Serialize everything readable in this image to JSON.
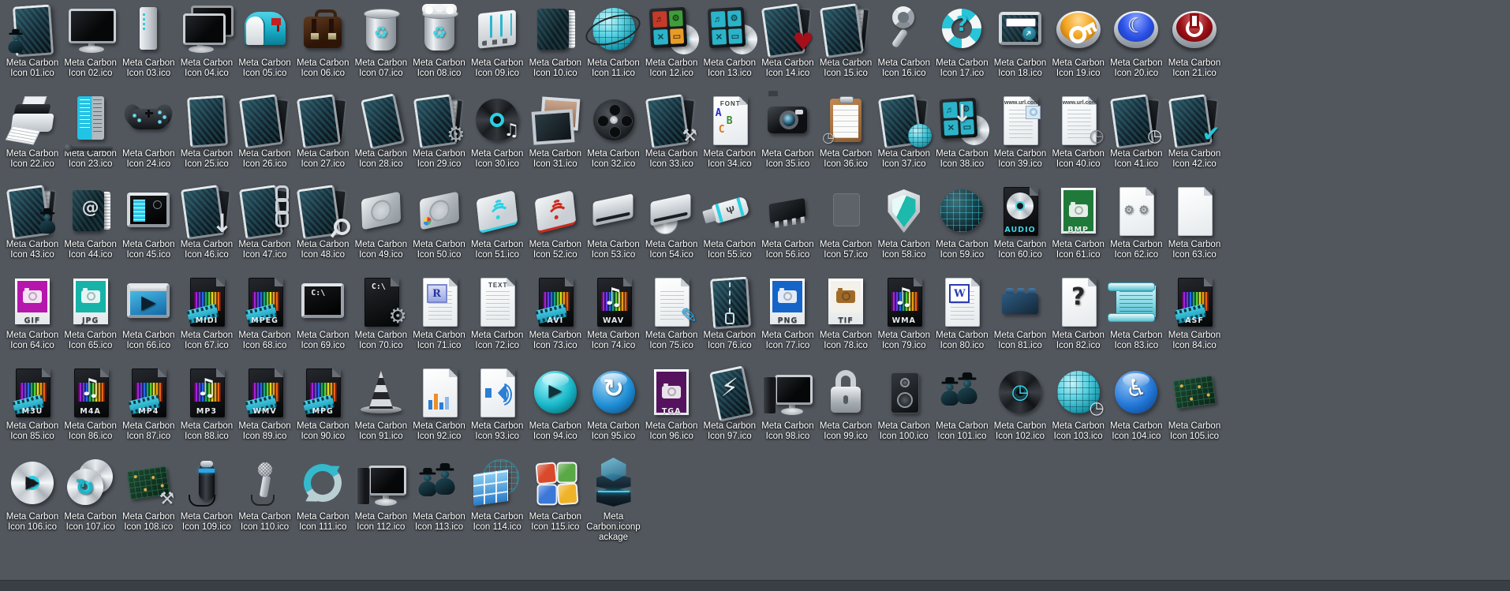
{
  "desktop": {
    "background": "#52575e",
    "bottom_bar_color": "#3a3e45",
    "label_color": "#ffffff",
    "accent_cyan": "#2bd0e4"
  },
  "items": [
    {
      "t": "Meta Carbon Icon 01.ico",
      "s": "user-panel-icon",
      "i": {
        "b": "carbon",
        "g": "user"
      }
    },
    {
      "t": "Meta Carbon Icon 02.ico",
      "s": "monitor-icon",
      "i": {
        "b": "monitor"
      }
    },
    {
      "t": "Meta Carbon Icon 03.ico",
      "s": "computer-tower-icon",
      "i": {
        "b": "tower"
      }
    },
    {
      "t": "Meta Carbon Icon 04.ico",
      "s": "dual-monitor-icon",
      "i": {
        "b": "monitor",
        "v": "dbl"
      }
    },
    {
      "t": "Meta Carbon Icon 05.ico",
      "s": "mailbox-icon",
      "i": {
        "b": "mailbox"
      }
    },
    {
      "t": "Meta Carbon Icon 06.ico",
      "s": "briefcase-icon",
      "i": {
        "b": "briefcase"
      }
    },
    {
      "t": "Meta Carbon Icon 07.ico",
      "s": "recycle-bin-empty-icon",
      "i": {
        "b": "trash",
        "g": "recycle"
      }
    },
    {
      "t": "Meta Carbon Icon 08.ico",
      "s": "recycle-bin-full-icon",
      "i": {
        "b": "trash",
        "v": "full",
        "g": "recycle"
      }
    },
    {
      "t": "Meta Carbon Icon 09.ico",
      "s": "mixer-panel-icon",
      "i": {
        "b": "mixer"
      }
    },
    {
      "t": "Meta Carbon Icon 10.ico",
      "s": "book-icon",
      "i": {
        "b": "book"
      }
    },
    {
      "t": "Meta Carbon Icon 11.ico",
      "s": "network-globe-icon",
      "i": {
        "b": "globe",
        "v": "orbit"
      }
    },
    {
      "t": "Meta Carbon Icon 12.ico",
      "s": "software-disc-icon",
      "i": {
        "b": "tiles",
        "v": "multi"
      }
    },
    {
      "t": "Meta Carbon Icon 13.ico",
      "s": "software-disc-cyan-icon",
      "i": {
        "b": "tiles"
      }
    },
    {
      "t": "Meta Carbon Icon 14.ico",
      "s": "favorites-folder-icon",
      "i": {
        "b": "carbon",
        "o": 1,
        "g": "heart"
      }
    },
    {
      "t": "Meta Carbon Icon 15.ico",
      "s": "documents-folder-icon",
      "i": {
        "b": "carbon",
        "o": 1,
        "p": 1
      }
    },
    {
      "t": "Meta Carbon Icon 16.ico",
      "s": "magnifier-icon",
      "i": {
        "b": "lens"
      }
    },
    {
      "t": "Meta Carbon Icon 17.ico",
      "s": "help-lifebuoy-icon",
      "i": {
        "b": "buoy",
        "g": "q"
      }
    },
    {
      "t": "Meta Carbon Icon 18.ico",
      "s": "run-dialog-icon",
      "i": {
        "b": "runbox"
      }
    },
    {
      "t": "Meta Carbon Icon 19.ico",
      "s": "key-button-icon",
      "i": {
        "b": "button",
        "c": "orange",
        "g": "key"
      }
    },
    {
      "t": "Meta Carbon Icon 20.ico",
      "s": "sleep-button-icon",
      "i": {
        "b": "button",
        "c": "blue",
        "g": "moon"
      }
    },
    {
      "t": "Meta Carbon Icon 21.ico",
      "s": "power-button-icon",
      "i": {
        "b": "button",
        "c": "red",
        "g": "power"
      }
    },
    {
      "t": "Meta Carbon Icon 22.ico",
      "s": "printer-icon",
      "i": {
        "b": "printer"
      }
    },
    {
      "t": "Meta Carbon Icon 23.ico",
      "s": "start-menu-icon",
      "i": {
        "b": "startmenu"
      }
    },
    {
      "t": "Meta Carbon Icon 24.ico",
      "s": "gamepad-icon",
      "i": {
        "b": "gamepad"
      }
    },
    {
      "t": "Meta Carbon Icon 25.ico",
      "s": "carbon-panel-icon",
      "i": {
        "b": "carbon"
      }
    },
    {
      "t": "Meta Carbon Icon 26.ico",
      "s": "open-folder-icon",
      "i": {
        "b": "carbon",
        "o": 1
      }
    },
    {
      "t": "Meta Carbon Icon 27.ico",
      "s": "open-folder-icon",
      "i": {
        "b": "carbon",
        "o": 1
      }
    },
    {
      "t": "Meta Carbon Icon 28.ico",
      "s": "carbon-flat-panel-icon",
      "i": {
        "b": "carbon",
        "v": "flat"
      }
    },
    {
      "t": "Meta Carbon Icon 29.ico",
      "s": "system-folder-icon",
      "i": {
        "b": "carbon",
        "o": 1,
        "p": 1,
        "g": "gear"
      }
    },
    {
      "t": "Meta Carbon Icon 30.ico",
      "s": "vinyl-record-icon",
      "i": {
        "b": "cd",
        "v": "dark",
        "g": "noteS",
        "rc": "#2bd0e4"
      }
    },
    {
      "t": "Meta Carbon Icon 31.ico",
      "s": "picture-frames-icon",
      "i": {
        "b": "frames"
      }
    },
    {
      "t": "Meta Carbon Icon 32.ico",
      "s": "film-reel-icon",
      "i": {
        "b": "reel"
      }
    },
    {
      "t": "Meta Carbon Icon 33.ico",
      "s": "tools-folder-icon",
      "i": {
        "b": "carbon",
        "o": 1,
        "g": "tools"
      }
    },
    {
      "t": "Meta Carbon Icon 34.ico",
      "s": "font-file-icon",
      "i": {
        "b": "page",
        "h": "FONT",
        "g": "abc"
      }
    },
    {
      "t": "Meta Carbon Icon 35.ico",
      "s": "camera-icon",
      "i": {
        "b": "camera"
      }
    },
    {
      "t": "Meta Carbon Icon 36.ico",
      "s": "task-clipboard-icon",
      "i": {
        "b": "clipboard",
        "g": "watchS"
      }
    },
    {
      "t": "Meta Carbon Icon 37.ico",
      "s": "network-folder-icon",
      "i": {
        "b": "carbon",
        "o": 1,
        "g": "globe-sm"
      }
    },
    {
      "t": "Meta Carbon Icon 38.ico",
      "s": "download-software-icon",
      "i": {
        "b": "tiles",
        "g": "downC"
      }
    },
    {
      "t": "Meta Carbon Icon 39.ico",
      "s": "url-document-icon",
      "i": {
        "b": "page",
        "h": "www.url.com",
        "l": 1,
        "g": "webpic"
      }
    },
    {
      "t": "Meta Carbon Icon 40.ico",
      "s": "url-history-icon",
      "i": {
        "b": "page",
        "h": "www.url.com",
        "l": 1,
        "g": "watch",
        "gc": "#8f969c"
      }
    },
    {
      "t": "Meta Carbon Icon 41.ico",
      "s": "recent-folder-icon",
      "i": {
        "b": "carbon",
        "o": 1,
        "g": "watch"
      }
    },
    {
      "t": "Meta Carbon Icon 42.ico",
      "s": "approved-folder-icon",
      "i": {
        "b": "carbon",
        "o": 1,
        "g": "check"
      }
    },
    {
      "t": "Meta Carbon Icon 43.ico",
      "s": "user-folder-icon",
      "i": {
        "b": "carbon",
        "o": 1,
        "p": 1,
        "g": "spy"
      }
    },
    {
      "t": "Meta Carbon Icon 44.ico",
      "s": "address-book-icon",
      "i": {
        "b": "book",
        "g": "at"
      }
    },
    {
      "t": "Meta Carbon Icon 45.ico",
      "s": "media-screen-icon",
      "i": {
        "b": "screenmenu"
      }
    },
    {
      "t": "Meta Carbon Icon 46.ico",
      "s": "downloads-folder-icon",
      "i": {
        "b": "carbon",
        "o": 1,
        "g": "down"
      }
    },
    {
      "t": "Meta Carbon Icon 47.ico",
      "s": "linked-folder-icon",
      "i": {
        "b": "carbon",
        "o": 1,
        "g": "chain"
      }
    },
    {
      "t": "Meta Carbon Icon 48.ico",
      "s": "search-folder-icon",
      "i": {
        "b": "carbon",
        "o": 1,
        "g": "lens-sm"
      }
    },
    {
      "t": "Meta Carbon Icon 49.ico",
      "s": "hard-drive-icon",
      "i": {
        "b": "hdd"
      }
    },
    {
      "t": "Meta Carbon Icon 50.ico",
      "s": "hard-drive-brand-icon",
      "i": {
        "b": "hdd",
        "v": "logo"
      }
    },
    {
      "t": "Meta Carbon Icon 51.ico",
      "s": "wireless-drive-cyan-icon",
      "i": {
        "b": "wifidrive",
        "c": "#2bd0e4"
      }
    },
    {
      "t": "Meta Carbon Icon 52.ico",
      "s": "wireless-drive-red-icon",
      "i": {
        "b": "wifidrive",
        "c": "#cf2a1c"
      }
    },
    {
      "t": "Meta Carbon Icon 53.ico",
      "s": "optical-drive-icon",
      "i": {
        "b": "optical"
      }
    },
    {
      "t": "Meta Carbon Icon 54.ico",
      "s": "optical-drive-disc-icon",
      "i": {
        "b": "optical",
        "v": "disc"
      }
    },
    {
      "t": "Meta Carbon Icon 55.ico",
      "s": "usb-stick-icon",
      "i": {
        "b": "usb"
      }
    },
    {
      "t": "Meta Carbon Icon 56.ico",
      "s": "memory-chip-icon",
      "i": {
        "b": "chip"
      }
    },
    {
      "t": "Meta Carbon Icon 57.ico",
      "s": "hidden-item-icon",
      "i": {
        "b": "ghost"
      }
    },
    {
      "t": "Meta Carbon Icon 58.ico",
      "s": "security-shield-icon",
      "i": {
        "b": "shield"
      }
    },
    {
      "t": "Meta Carbon Icon 59.ico",
      "s": "dark-globe-icon",
      "i": {
        "b": "globe",
        "v": "dark"
      }
    },
    {
      "t": "Meta Carbon Icon 60.ico",
      "s": "audio-cd-file-icon",
      "i": {
        "b": "darkpage",
        "g": "cd-sm",
        "bd": "AUDIO",
        "bc": "#3fd4e6"
      }
    },
    {
      "t": "Meta Carbon Icon 61.ico",
      "s": "bmp-file-icon",
      "i": {
        "b": "photocard",
        "c": "#1f7a3a",
        "v": "full",
        "bd": "BMP",
        "bc": "#eef2f4"
      }
    },
    {
      "t": "Meta Carbon Icon 62.ico",
      "s": "settings-document-icon",
      "i": {
        "b": "page",
        "g": "gears"
      }
    },
    {
      "t": "Meta Carbon Icon 63.ico",
      "s": "blank-document-icon",
      "i": {
        "b": "page"
      }
    },
    {
      "t": "Meta Carbon Icon 64.ico",
      "s": "gif-file-icon",
      "i": {
        "b": "photocard",
        "c": "#b517ad",
        "bd": "GIF",
        "bc": "#3a3f45"
      }
    },
    {
      "t": "Meta Carbon Icon 65.ico",
      "s": "jpg-file-icon",
      "i": {
        "b": "photocard",
        "c": "#17b3a8",
        "bd": "JPG",
        "bc": "#3a3f45"
      }
    },
    {
      "t": "Meta Carbon Icon 66.ico",
      "s": "video-player-icon",
      "i": {
        "b": "playscreen"
      }
    },
    {
      "t": "Meta Carbon Icon 67.ico",
      "s": "midi-file-icon",
      "i": {
        "b": "darkpage",
        "r": 1,
        "g": "film",
        "bd": "MIDI"
      }
    },
    {
      "t": "Meta Carbon Icon 68.ico",
      "s": "mpeg-file-icon",
      "i": {
        "b": "darkpage",
        "r": 1,
        "g": "film",
        "bd": "MPEG"
      }
    },
    {
      "t": "Meta Carbon Icon 69.ico",
      "s": "command-prompt-icon",
      "i": {
        "b": "terminal",
        "h": "C:\\"
      }
    },
    {
      "t": "Meta Carbon Icon 70.ico",
      "s": "command-file-icon",
      "i": {
        "b": "darkpage",
        "h": "C:\\",
        "g": "gear"
      }
    },
    {
      "t": "Meta Carbon Icon 71.ico",
      "s": "rtf-document-icon",
      "i": {
        "b": "page",
        "l": 1,
        "g": "rlogo"
      }
    },
    {
      "t": "Meta Carbon Icon 72.ico",
      "s": "text-document-icon",
      "i": {
        "b": "page",
        "h": "TEXT",
        "l": 1
      }
    },
    {
      "t": "Meta Carbon Icon 73.ico",
      "s": "avi-file-icon",
      "i": {
        "b": "darkpage",
        "r": 1,
        "g": "film",
        "bd": "AVI"
      }
    },
    {
      "t": "Meta Carbon Icon 74.ico",
      "s": "wav-file-icon",
      "i": {
        "b": "darkpage",
        "r": 1,
        "g": "note",
        "bd": "WAV"
      }
    },
    {
      "t": "Meta Carbon Icon 75.ico",
      "s": "notes-document-icon",
      "i": {
        "b": "page",
        "l": 1,
        "g": "pencil"
      }
    },
    {
      "t": "Meta Carbon Icon 76.ico",
      "s": "zip-folder-icon",
      "i": {
        "b": "carbon",
        "g": "zip"
      }
    },
    {
      "t": "Meta Carbon Icon 77.ico",
      "s": "png-file-icon",
      "i": {
        "b": "photocard",
        "c": "#1565c8",
        "bd": "PNG",
        "bc": "#3a3f45"
      }
    },
    {
      "t": "Meta Carbon Icon 78.ico",
      "s": "tif-file-icon",
      "i": {
        "b": "photocard",
        "c": "#f4f0ea",
        "cc": "#a06a28",
        "bd": "TIF",
        "bc": "#3a3f45"
      }
    },
    {
      "t": "Meta Carbon Icon 79.ico",
      "s": "wma-file-icon",
      "i": {
        "b": "darkpage",
        "r": 1,
        "g": "note",
        "bd": "WMA"
      }
    },
    {
      "t": "Meta Carbon Icon 80.ico",
      "s": "word-document-icon",
      "i": {
        "b": "page",
        "l": 1,
        "g": "wlogo"
      }
    },
    {
      "t": "Meta Carbon Icon 81.ico",
      "s": "building-block-icon",
      "i": {
        "b": "brick"
      }
    },
    {
      "t": "Meta Carbon Icon 82.ico",
      "s": "unknown-file-icon",
      "i": {
        "b": "page",
        "g": "qd"
      }
    },
    {
      "t": "Meta Carbon Icon 83.ico",
      "s": "scroll-document-icon",
      "i": {
        "b": "scroll"
      }
    },
    {
      "t": "Meta Carbon Icon 84.ico",
      "s": "asf-file-icon",
      "i": {
        "b": "darkpage",
        "r": 1,
        "g": "film",
        "bd": "ASF"
      }
    },
    {
      "t": "Meta Carbon Icon 85.ico",
      "s": "m3u-file-icon",
      "i": {
        "b": "darkpage",
        "r": 1,
        "g": "film",
        "bd": "M3U"
      }
    },
    {
      "t": "Meta Carbon Icon 86.ico",
      "s": "m4a-file-icon",
      "i": {
        "b": "darkpage",
        "r": 1,
        "g": "note",
        "bd": "M4A"
      }
    },
    {
      "t": "Meta Carbon Icon 87.ico",
      "s": "mp4-file-icon",
      "i": {
        "b": "darkpage",
        "r": 1,
        "g": "film",
        "bd": "MP4"
      }
    },
    {
      "t": "Meta Carbon Icon 88.ico",
      "s": "mp3-file-icon",
      "i": {
        "b": "darkpage",
        "r": 1,
        "g": "note",
        "bd": "MP3"
      }
    },
    {
      "t": "Meta Carbon Icon 89.ico",
      "s": "wmv-file-icon",
      "i": {
        "b": "darkpage",
        "r": 1,
        "g": "film",
        "bd": "WMV"
      }
    },
    {
      "t": "Meta Carbon Icon 90.ico",
      "s": "mpg-file-icon",
      "i": {
        "b": "darkpage",
        "r": 1,
        "g": "film",
        "bd": "MPG"
      }
    },
    {
      "t": "Meta Carbon Icon 91.ico",
      "s": "traffic-cone-icon",
      "i": {
        "b": "cone"
      }
    },
    {
      "t": "Meta Carbon Icon 92.ico",
      "s": "chart-document-icon",
      "i": {
        "b": "page",
        "g": "chart"
      }
    },
    {
      "t": "Meta Carbon Icon 93.ico",
      "s": "sound-document-icon",
      "i": {
        "b": "page",
        "g": "speaker"
      }
    },
    {
      "t": "Meta Carbon Icon 94.ico",
      "s": "play-orb-icon",
      "i": {
        "b": "orb",
        "c": "teal",
        "g": "play"
      }
    },
    {
      "t": "Meta Carbon Icon 95.ico",
      "s": "torrent-orb-icon",
      "i": {
        "b": "orb",
        "c": "blue",
        "g": "swirl"
      }
    },
    {
      "t": "Meta Carbon Icon 96.ico",
      "s": "tga-file-icon",
      "i": {
        "b": "photocard",
        "c": "#55135e",
        "v": "full",
        "bd": "TGA",
        "bc": "#eef2f4"
      }
    },
    {
      "t": "Meta Carbon Icon 97.ico",
      "s": "lightning-icon",
      "i": {
        "b": "carbon",
        "v": "flat",
        "g": "bolt"
      }
    },
    {
      "t": "Meta Carbon Icon 98.ico",
      "s": "media-workstation-icon",
      "i": {
        "b": "monitor",
        "v": "tower"
      }
    },
    {
      "t": "Meta Carbon Icon 99.ico",
      "s": "padlock-icon",
      "i": {
        "b": "lock"
      }
    },
    {
      "t": "Meta Carbon Icon 100.ico",
      "s": "loudspeaker-icon",
      "i": {
        "b": "speakerbox"
      }
    },
    {
      "t": "Meta Carbon Icon 101.ico",
      "s": "spy-users-icon",
      "i": {
        "b": "spies"
      }
    },
    {
      "t": "Meta Carbon Icon 102.ico",
      "s": "disc-time-icon",
      "i": {
        "b": "cd",
        "v": "dark",
        "g": "clock",
        "rc": "#17404a"
      }
    },
    {
      "t": "Meta Carbon Icon 103.ico",
      "s": "globe-time-icon",
      "i": {
        "b": "globe",
        "g": "watch"
      }
    },
    {
      "t": "Meta Carbon Icon 104.ico",
      "s": "accessibility-orb-icon",
      "i": {
        "b": "orb",
        "c": "mblue",
        "g": "wheel"
      }
    },
    {
      "t": "Meta Carbon Icon 105.ico",
      "s": "circuit-board-icon",
      "i": {
        "b": "pcb"
      }
    },
    {
      "t": "Meta Carbon Icon 106.ico",
      "s": "disc-play-icon",
      "i": {
        "b": "cd",
        "g": "playD",
        "rc": "#2bd0e4"
      }
    },
    {
      "t": "Meta Carbon Icon 107.ico",
      "s": "disc-sync-icon",
      "i": {
        "b": "cd",
        "v": "dbl",
        "g": "swirlT",
        "rc": "#2bd0e4"
      }
    },
    {
      "t": "Meta Carbon Icon 108.ico",
      "s": "circuit-tools-icon",
      "i": {
        "b": "pcb",
        "g": "tools"
      }
    },
    {
      "t": "Meta Carbon Icon 109.ico",
      "s": "battery-icon",
      "i": {
        "b": "battery"
      }
    },
    {
      "t": "Meta Carbon Icon 110.ico",
      "s": "microphone-icon",
      "i": {
        "b": "mic"
      }
    },
    {
      "t": "Meta Carbon Icon 111.ico",
      "s": "refresh-arrows-icon",
      "i": {
        "b": "refresh"
      }
    },
    {
      "t": "Meta Carbon Icon 112.ico",
      "s": "computer-setup-icon",
      "i": {
        "b": "monitor",
        "v": "tower"
      }
    },
    {
      "t": "Meta Carbon Icon 113.ico",
      "s": "spy-users-icon",
      "i": {
        "b": "spies"
      }
    },
    {
      "t": "Meta Carbon Icon 114.ico",
      "s": "firewall-icon",
      "i": {
        "b": "wall"
      }
    },
    {
      "t": "Meta Carbon Icon 115.ico",
      "s": "windows-logo-icon",
      "i": {
        "b": "winlogo"
      }
    },
    {
      "t": "Meta Carbon.iconpackage",
      "s": "icon-package-cubes",
      "i": {
        "b": "cubes"
      }
    }
  ]
}
